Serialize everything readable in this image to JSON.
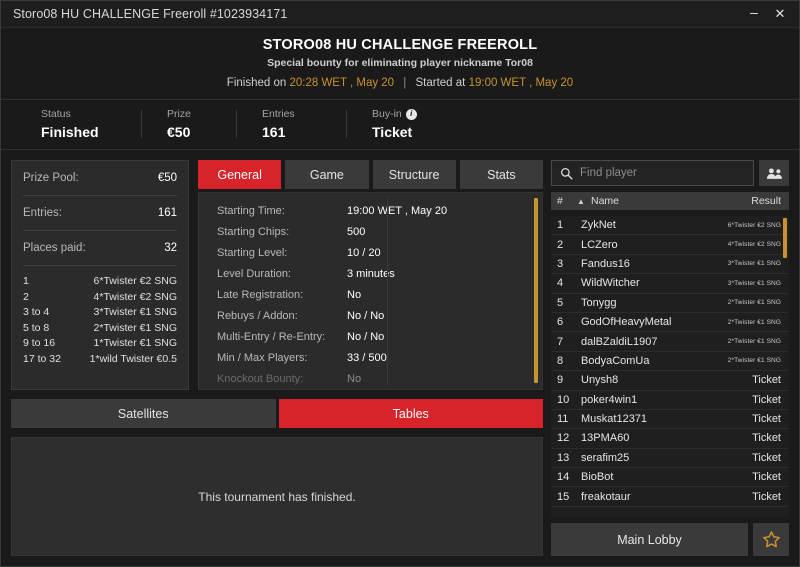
{
  "window": {
    "title": "Storo08 HU CHALLENGE Freeroll #1023934171",
    "minimize_label": "–",
    "close_label": "✕"
  },
  "header": {
    "title": "STORO08 HU CHALLENGE FREEROLL",
    "subtitle": "Special bounty for eliminating player nickname Tor08",
    "finished_label": "Finished on",
    "finished_time": "20:28 WET , May 20",
    "separator": "|",
    "started_label": "Started at",
    "started_time": "19:00 WET , May 20"
  },
  "stats": [
    {
      "label": "Status",
      "value": "Finished",
      "info": false
    },
    {
      "label": "Prize",
      "value": "€50",
      "info": false
    },
    {
      "label": "Entries",
      "value": "161",
      "info": false
    },
    {
      "label": "Buy-in",
      "value": "Ticket",
      "info": true
    }
  ],
  "prize_panel": {
    "rows": [
      {
        "key": "Prize Pool:",
        "value": "€50"
      },
      {
        "key": "Entries:",
        "value": "161"
      },
      {
        "key": "Places paid:",
        "value": "32"
      }
    ],
    "payouts": [
      {
        "from": "1",
        "to": "",
        "prize": "6*Twister €2 SNG"
      },
      {
        "from": "2",
        "to": "",
        "prize": "4*Twister €2 SNG"
      },
      {
        "from": "3",
        "to": "4",
        "prize": "3*Twister €1 SNG"
      },
      {
        "from": "5",
        "to": "8",
        "prize": "2*Twister €1 SNG"
      },
      {
        "from": "9",
        "to": "16",
        "prize": "1*Twister €1 SNG"
      },
      {
        "from": "17",
        "to": "32",
        "prize": "1*wild Twister €0.5"
      }
    ],
    "to_word": "to"
  },
  "tabs": [
    {
      "label": "General",
      "active": true
    },
    {
      "label": "Game",
      "active": false
    },
    {
      "label": "Structure",
      "active": false
    },
    {
      "label": "Stats",
      "active": false
    }
  ],
  "general": [
    {
      "key": "Starting Time:",
      "value": "19:00 WET , May 20"
    },
    {
      "key": "Starting Chips:",
      "value": "500"
    },
    {
      "key": "Starting Level:",
      "value": "10 / 20"
    },
    {
      "key": "Level Duration:",
      "value": "3 minutes"
    },
    {
      "key": "Late Registration:",
      "value": "No"
    },
    {
      "key": "Rebuys / Addon:",
      "value": "No / No"
    },
    {
      "key": "Multi-Entry / Re-Entry:",
      "value": "No / No"
    },
    {
      "key": "Min / Max Players:",
      "value": "33 / 500"
    },
    {
      "key": "Knockout Bounty:",
      "value": "No"
    }
  ],
  "section_buttons": [
    {
      "label": "Satellites",
      "active": false
    },
    {
      "label": "Tables",
      "active": true
    }
  ],
  "finished_message": "This tournament has finished.",
  "search": {
    "placeholder": "Find player",
    "value": "",
    "icon": "search-icon",
    "people_icon": "people-icon"
  },
  "player_table": {
    "columns": {
      "num": "#",
      "sort": "▲",
      "name": "Name",
      "result": "Result"
    },
    "rows": [
      {
        "num": "1",
        "name": "ZykNet",
        "result": "6*Twister €2 SNG",
        "small": true
      },
      {
        "num": "2",
        "name": "LCZero",
        "result": "4*Twister €2 SNG",
        "small": true
      },
      {
        "num": "3",
        "name": "Fandus16",
        "result": "3*Twister €1 SNG",
        "small": true
      },
      {
        "num": "4",
        "name": "WildWitcher",
        "result": "3*Twister €1 SNG",
        "small": true
      },
      {
        "num": "5",
        "name": "Tonygg",
        "result": "2*Twister €1 SNG",
        "small": true
      },
      {
        "num": "6",
        "name": "GodOfHeavyMetal",
        "result": "2*Twister €1 SNG",
        "small": true
      },
      {
        "num": "7",
        "name": "dalBZaldiL1907",
        "result": "2*Twister €1 SNG",
        "small": true
      },
      {
        "num": "8",
        "name": "BodyaComUa",
        "result": "2*Twister €1 SNG",
        "small": true
      },
      {
        "num": "9",
        "name": "Unysh8",
        "result": "Ticket",
        "small": false
      },
      {
        "num": "10",
        "name": "poker4win1",
        "result": "Ticket",
        "small": false
      },
      {
        "num": "11",
        "name": "Muskat12371",
        "result": "Ticket",
        "small": false
      },
      {
        "num": "12",
        "name": "13PMA60",
        "result": "Ticket",
        "small": false
      },
      {
        "num": "13",
        "name": "serafim25",
        "result": "Ticket",
        "small": false
      },
      {
        "num": "14",
        "name": "BioBot",
        "result": "Ticket",
        "small": false
      },
      {
        "num": "15",
        "name": "freakotaur",
        "result": "Ticket",
        "small": false
      }
    ]
  },
  "footer": {
    "main_lobby_label": "Main Lobby",
    "star_icon": "star-icon"
  },
  "colors": {
    "accent_red": "#d8232a",
    "amber": "#c8922e",
    "panel": "#2b2b2b",
    "background": "#1a1a1a"
  }
}
